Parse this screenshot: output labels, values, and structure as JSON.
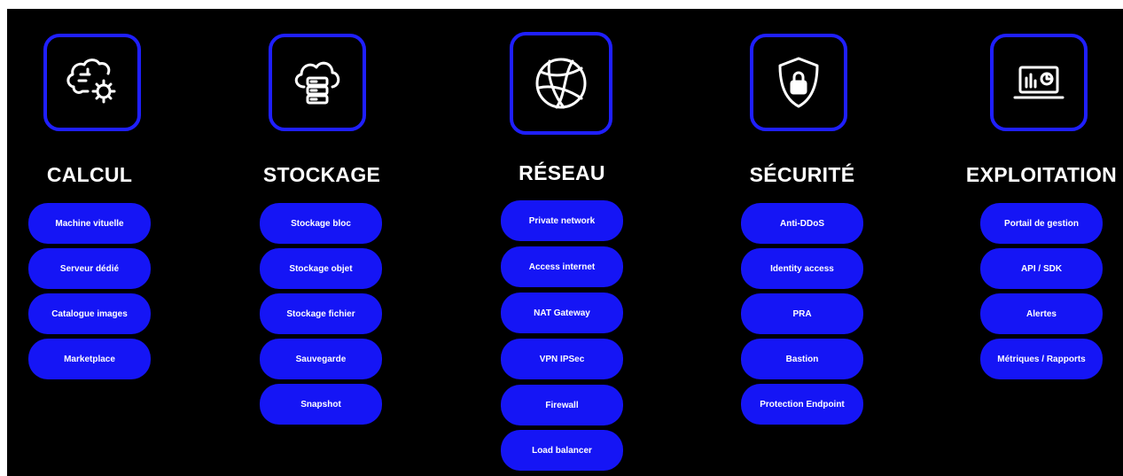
{
  "accent_color": "#1515f5",
  "border_color": "#1f1fff",
  "columns": [
    {
      "icon": "brain-gear-icon",
      "title": "CALCUL",
      "items": [
        "Machine vituelle",
        "Serveur dédié",
        "Catalogue images",
        "Marketplace"
      ]
    },
    {
      "icon": "cloud-server-icon",
      "title": "STOCKAGE",
      "items": [
        "Stockage bloc",
        "Stockage objet",
        "Stockage fichier",
        "Sauvegarde",
        "Snapshot"
      ]
    },
    {
      "icon": "globe-network-icon",
      "title": "RÉSEAU",
      "items": [
        "Private network",
        "Access internet",
        "NAT Gateway",
        "VPN IPSec",
        "Firewall",
        "Load balancer"
      ]
    },
    {
      "icon": "shield-lock-icon",
      "title": "SÉCURITÉ",
      "items": [
        "Anti-DDoS",
        "Identity access",
        "PRA",
        "Bastion",
        "Protection Endpoint"
      ]
    },
    {
      "icon": "laptop-chart-icon",
      "title": "EXPLOITATION",
      "items": [
        "Portail de gestion",
        "API / SDK",
        "Alertes",
        "Métriques / Rapports"
      ]
    }
  ]
}
